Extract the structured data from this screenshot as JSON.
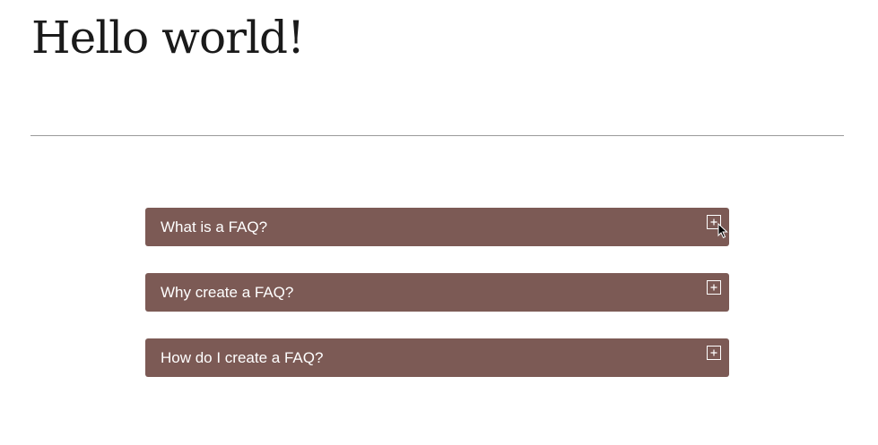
{
  "page": {
    "title": "Hello world!"
  },
  "faq": {
    "items": [
      {
        "question": "What is a FAQ?",
        "toggle_icon": "plus-icon",
        "expanded": false
      },
      {
        "question": "Why create a FAQ?",
        "toggle_icon": "plus-icon",
        "expanded": false
      },
      {
        "question": "How do I create a FAQ?",
        "toggle_icon": "plus-icon",
        "expanded": false
      }
    ]
  },
  "colors": {
    "accordion_bg": "#7c5a55",
    "accordion_text": "#ffffff",
    "divider": "#9a9a9a",
    "title_text": "#1a1a1a"
  }
}
